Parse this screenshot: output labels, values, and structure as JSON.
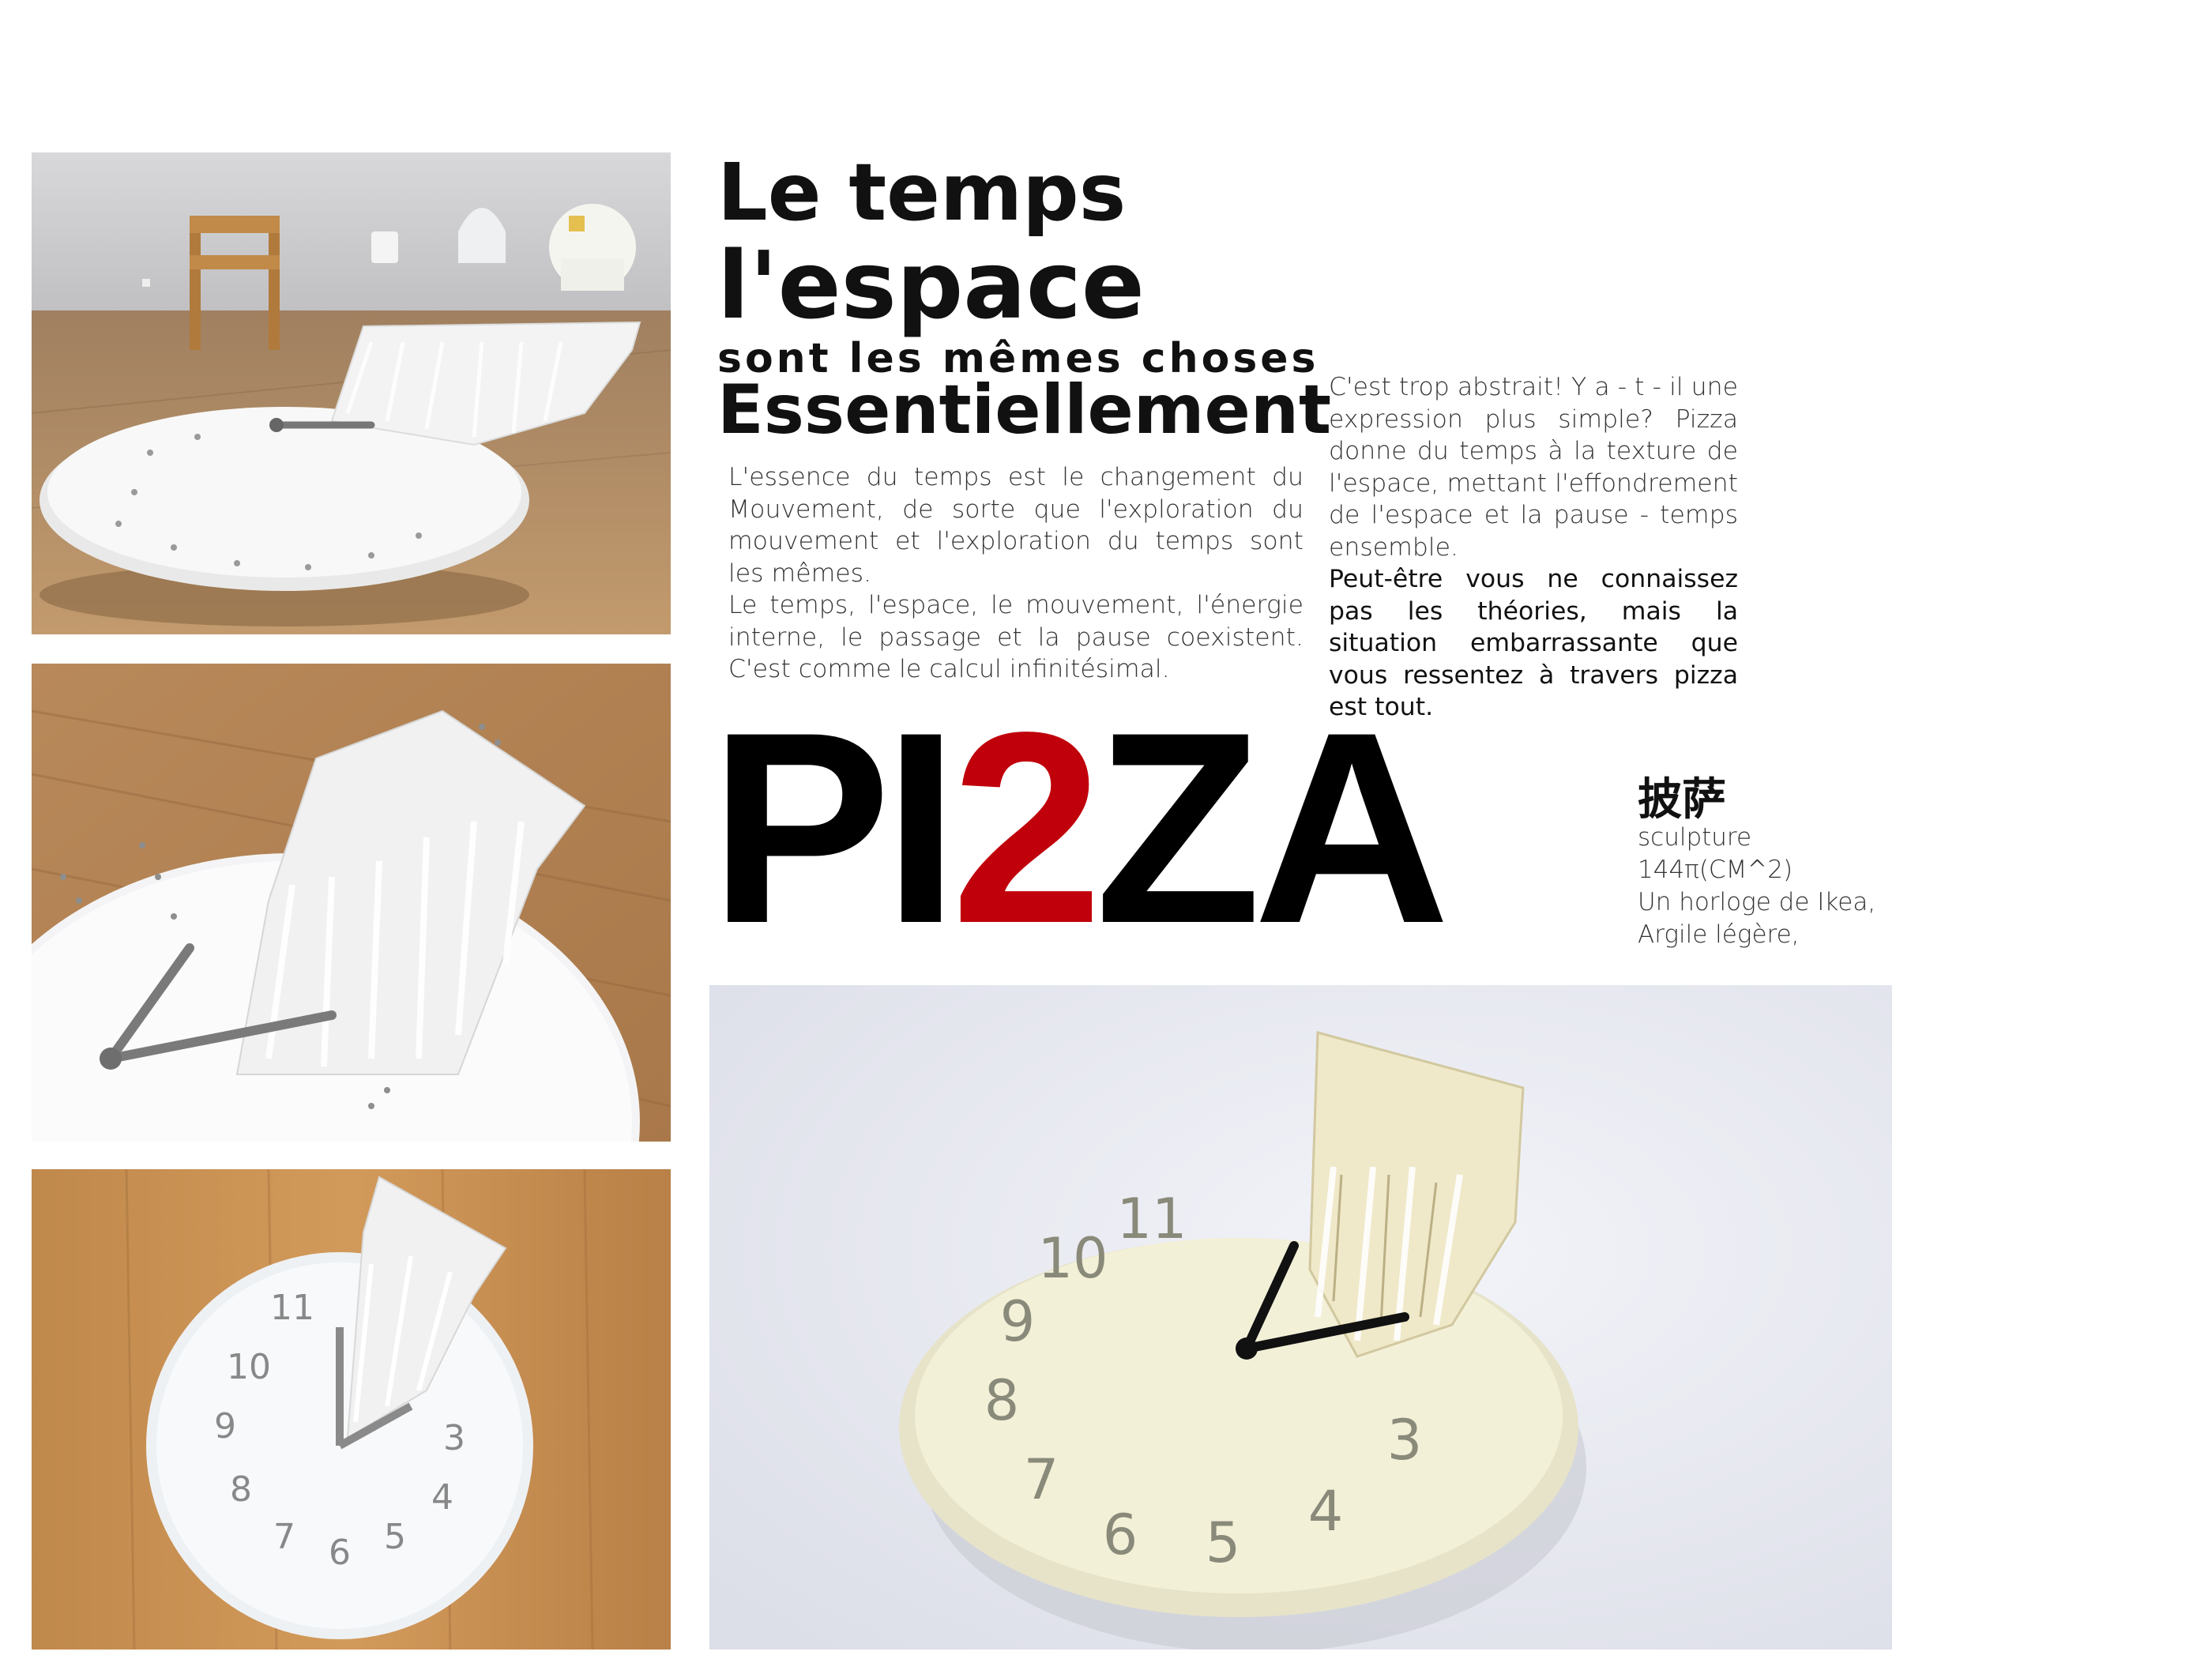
{
  "headline": {
    "line1": "Le temps",
    "line2": "l'espace",
    "line3": "sont les mêmes choses",
    "line4": "Essentiellement"
  },
  "left_paragraph": [
    "L'essence du temps est le changement du Mouvement, de sorte que l'exploration du mouvement et l'exploration du temps sont les mêmes.",
    "Le temps, l'espace, le mouvement, l'énergie interne, le passage et la pause coexistent. C'est comme le calcul infinitésimal."
  ],
  "right_paragraph": {
    "normal": "C'est trop abstrait! Y a - t - il une expression plus simple? Pizza donne du temps à la texture de l'espace, mettant l'effondrement de l'espace et la pause - temps ensemble.",
    "emphasis": "Peut-être vous ne connaissez pas les théories, mais la situation embarrassante que vous ressentez à travers pizza est tout."
  },
  "title_word": {
    "part1": "PI",
    "part2": "2",
    "part3": "ZA"
  },
  "chinese_title": "披萨",
  "info_lines": [
    "sculpture",
    "144π(CM^2)",
    "Un horloge de Ikea,",
    "Argile légère,"
  ],
  "colors": {
    "accent_red": "#c0000b",
    "text": "#111111"
  }
}
